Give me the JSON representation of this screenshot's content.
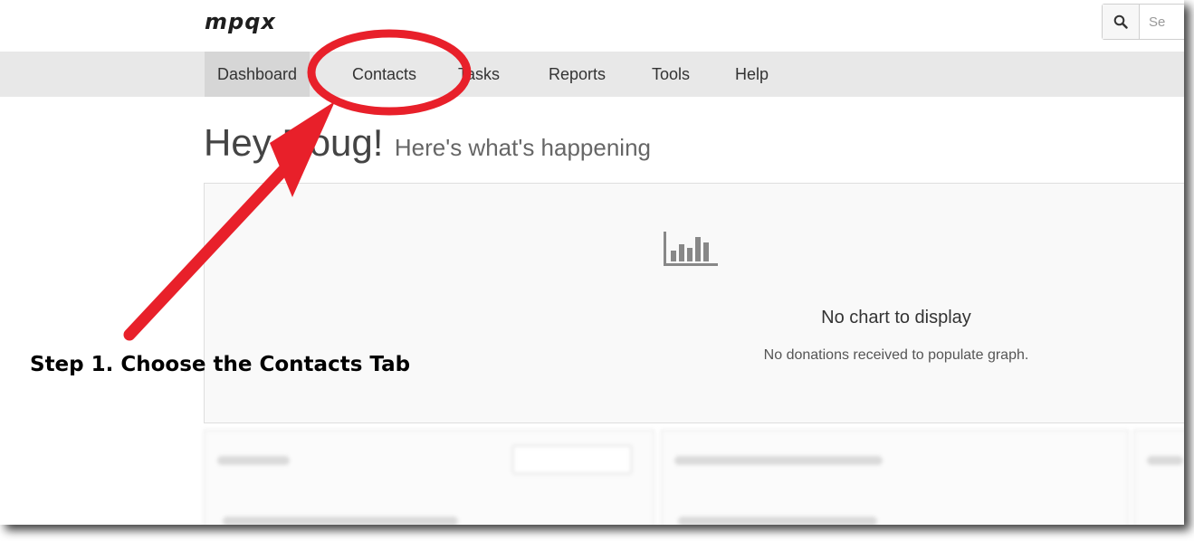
{
  "app": {
    "logo": "mpqx"
  },
  "search": {
    "placeholder": "Se"
  },
  "nav": {
    "items": [
      {
        "label": "Dashboard"
      },
      {
        "label": "Contacts"
      },
      {
        "label": "Tasks"
      },
      {
        "label": "Reports"
      },
      {
        "label": "Tools"
      },
      {
        "label": "Help"
      }
    ]
  },
  "greeting": {
    "big": "Hey Doug!",
    "small": "Here's what's happening"
  },
  "chart_panel": {
    "icon": "bar-chart-icon",
    "title": "No chart to display",
    "subtitle": "No donations received to populate graph."
  },
  "annotation": {
    "step_text": "Step 1. Choose the Contacts Tab",
    "color": "#e8202a"
  },
  "colors": {
    "navbar_bg": "#e8e8e8",
    "active_tab_bg": "#d6d6d6",
    "text_dark": "#333333"
  }
}
